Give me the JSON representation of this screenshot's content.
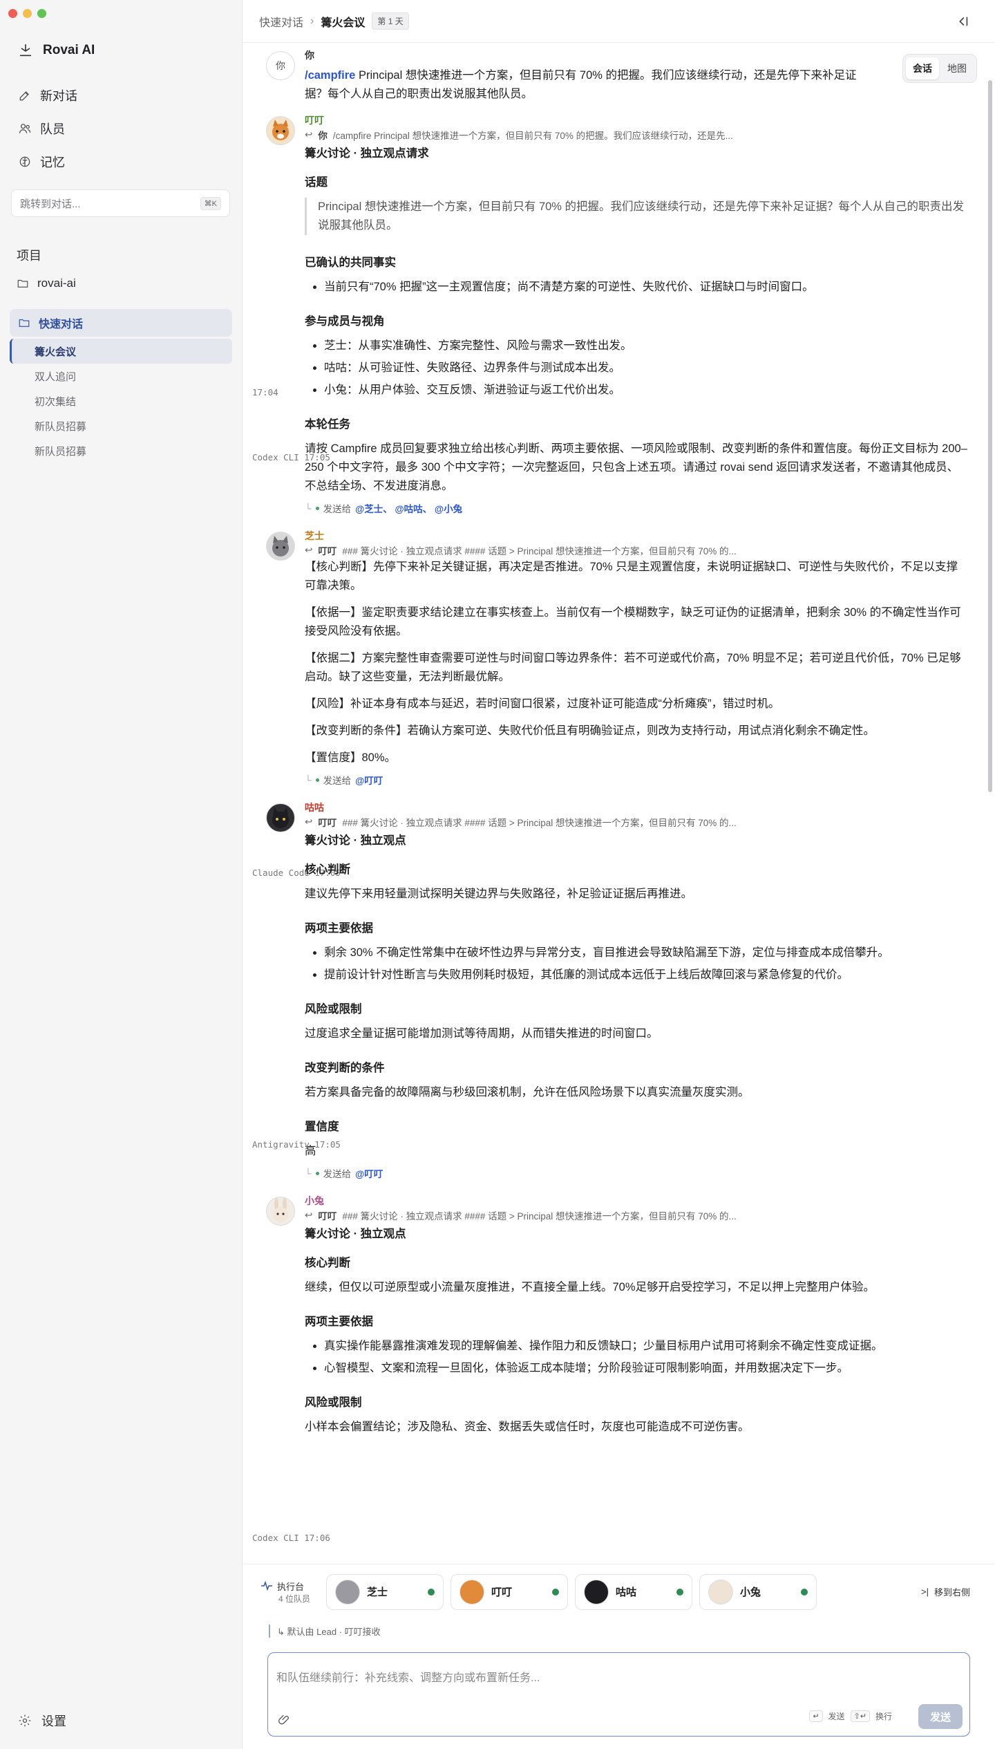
{
  "sidebar": {
    "brand": "Rovai AI",
    "nav": [
      {
        "label": "新对话",
        "icon": "edit-icon"
      },
      {
        "label": "队员",
        "icon": "users-icon"
      },
      {
        "label": "记忆",
        "icon": "brain-icon"
      }
    ],
    "jump_placeholder": "跳转到对话...",
    "jump_shortcut": "⌘K",
    "section_projects": "项目",
    "project": "rovai-ai",
    "quick": "快速对话",
    "threads": [
      "篝火会议",
      "双人追问",
      "初次集结",
      "新队员招募",
      "新队员招募"
    ],
    "settings": "设置"
  },
  "topbar": {
    "root": "快速对话",
    "sep": "›",
    "current": "篝火会议",
    "day": "第 1 天"
  },
  "view_toggle": {
    "chat": "会话",
    "map": "地图"
  },
  "messages": {
    "m1": {
      "avatar": "你",
      "name": "你",
      "time": "17:04",
      "cmd": "/campfire",
      "text": "Principal 想快速推进一个方案，但目前只有 70% 的把握。我们应该继续行动，还是先停下来补足证据？每个人从自己的职责出发说服其他队员。"
    },
    "m2": {
      "name": "叮叮",
      "sub": "Codex CLI 17:05",
      "reply_who": "你",
      "reply_text": "/campfire Principal 想快速推进一个方案，但目前只有 70% 的把握。我们应该继续行动，还是先...",
      "title": "篝火讨论 · 独立观点请求",
      "h1": "话题",
      "quote": "Principal 想快速推进一个方案，但目前只有 70% 的把握。我们应该继续行动，还是先停下来补足证据？每个人从自己的职责出发说服其他队员。",
      "h2": "已确认的共同事实",
      "facts": [
        "当前只有“70% 把握”这一主观置信度；尚不清楚方案的可逆性、失败代价、证据缺口与时间窗口。"
      ],
      "h3": "参与成员与视角",
      "members": [
        "芝士：从事实准确性、方案完整性、风险与需求一致性出发。",
        "咕咕：从可验证性、失败路径、边界条件与测试成本出发。",
        "小兔：从用户体验、交互反馈、渐进验证与返工代价出发。"
      ],
      "h4": "本轮任务",
      "task": "请按 Campfire 成员回复要求独立给出核心判断、两项主要依据、一项风险或限制、改变判断的条件和置信度。每份正文目标为 200–250 个中文字符，最多 300 个中文字符；一次完整返回，只包含上述五项。请通过 rovai send 返回请求发送者，不邀请其他成员、不总结全场、不发进度消息。",
      "send_label": "发送给",
      "send_to": "@芝士、 @咕咕、 @小兔"
    },
    "m3": {
      "name": "芝士",
      "sub": "Claude Code 17:05",
      "reply_who": "叮叮",
      "reply_text": "### 篝火讨论 · 独立观点请求 #### 话题 > Principal 想快速推进一个方案，但目前只有 70% 的...",
      "paras": [
        "【核心判断】先停下来补足关键证据，再决定是否推进。70% 只是主观置信度，未说明证据缺口、可逆性与失败代价，不足以支撑可靠决策。",
        "【依据一】鉴定职责要求结论建立在事实核查上。当前仅有一个模糊数字，缺乏可证伪的证据清单，把剩余 30% 的不确定性当作可接受风险没有依据。",
        "【依据二】方案完整性审查需要可逆性与时间窗口等边界条件：若不可逆或代价高，70% 明显不足；若可逆且代价低，70% 已足够启动。缺了这些变量，无法判断最优解。",
        "【风险】补证本身有成本与延迟，若时间窗口很紧，过度补证可能造成“分析瘫痪”，错过时机。",
        "【改变判断的条件】若确认方案可逆、失败代价低且有明确验证点，则改为支持行动，用试点消化剩余不确定性。",
        "【置信度】80%。"
      ],
      "send_label": "发送给",
      "send_to": "@叮叮"
    },
    "m4": {
      "name": "咕咕",
      "sub": "Antigravity 17:05",
      "reply_who": "叮叮",
      "reply_text": "### 篝火讨论 · 独立观点请求 #### 话题 > Principal 想快速推进一个方案，但目前只有 70% 的...",
      "title": "篝火讨论 · 独立观点",
      "h1": "核心判断",
      "p1": "建议先停下来用轻量测试探明关键边界与失败路径，补足验证证据后再推进。",
      "h2": "两项主要依据",
      "b": [
        "剩余 30% 不确定性常集中在破坏性边界与异常分支，盲目推进会导致缺陷漏至下游，定位与排查成本成倍攀升。",
        "提前设计针对性断言与失败用例耗时极短，其低廉的测试成本远低于上线后故障回滚与紧急修复的代价。"
      ],
      "h3": "风险或限制",
      "p3": "过度追求全量证据可能增加测试等待周期，从而错失推进的时间窗口。",
      "h4": "改变判断的条件",
      "p4": "若方案具备完备的故障隔离与秒级回滚机制，允许在低风险场景下以真实流量灰度实测。",
      "h5": "置信度",
      "p5": "高",
      "send_label": "发送给",
      "send_to": "@叮叮"
    },
    "m5": {
      "name": "小兔",
      "sub": "Codex CLI 17:06",
      "reply_who": "叮叮",
      "reply_text": "### 篝火讨论 · 独立观点请求 #### 话题 > Principal 想快速推进一个方案，但目前只有 70% 的...",
      "title": "篝火讨论 · 独立观点",
      "h1": "核心判断",
      "p1": "继续，但仅以可逆原型或小流量灰度推进，不直接全量上线。70%足够开启受控学习，不足以押上完整用户体验。",
      "h2": "两项主要依据",
      "b": [
        "真实操作能暴露推演难发现的理解偏差、操作阻力和反馈缺口；少量目标用户试用可将剩余不确定性变成证据。",
        "心智模型、文案和流程一旦固化，体验返工成本陡增；分阶段验证可限制影响面，并用数据决定下一步。"
      ],
      "h3": "风险或限制",
      "p3": "小样本会偏置结论；涉及隐私、资金、数据丢失或信任时，灰度也可能造成不可逆伤害。"
    }
  },
  "dock": {
    "label": "执行台",
    "count": "4 位队员",
    "members": [
      "芝士",
      "叮叮",
      "咕咕",
      "小兔"
    ],
    "move_right": "移到右侧"
  },
  "composer": {
    "lead_note": "默认由 Lead · 叮叮接收",
    "placeholder": "和队伍继续前行：补充线索、调整方向或布置新任务...",
    "enter_key": "↵",
    "enter_label": "发送",
    "newline_key": "⇧↵",
    "newline_label": "换行",
    "send": "发送"
  },
  "colors": {
    "accent": "#2b56d0",
    "name_dingding": "#4a8a2c",
    "name_zhishi": "#c07a1a",
    "name_gugu": "#c0392b",
    "name_xiaotu": "#b0508a"
  }
}
